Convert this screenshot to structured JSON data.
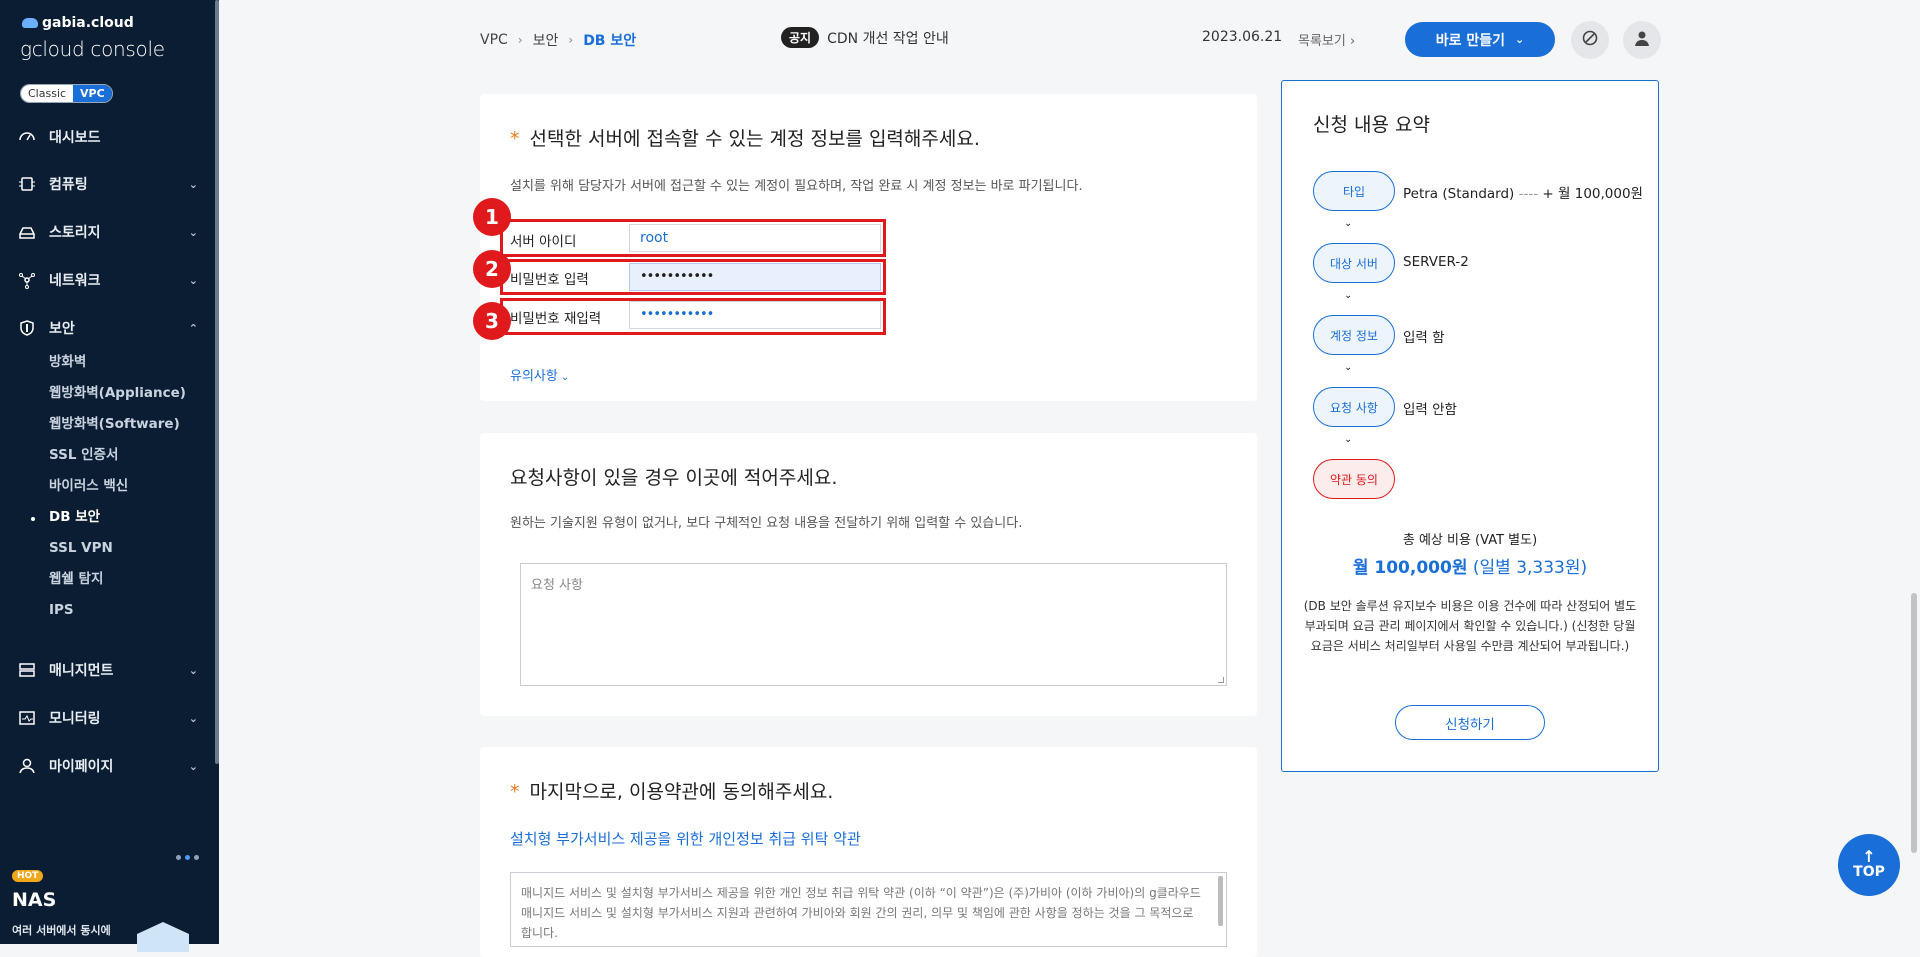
{
  "sidebar": {
    "brand_top": "gabia.cloud",
    "brand_main": "gcloud console",
    "mode_classic": "Classic",
    "mode_vpc": "VPC",
    "nav": {
      "dashboard": "대시보드",
      "computing": "컴퓨팅",
      "storage": "스토리지",
      "network": "네트워크",
      "security": "보안",
      "management": "매니지먼트",
      "monitoring": "모니터링",
      "mypage": "마이페이지"
    },
    "security_sub": [
      "방화벽",
      "웹방화벽(Appliance)",
      "웹방화벽(Software)",
      "SSL 인증서",
      "바이러스 백신",
      "DB 보안",
      "SSL VPN",
      "웹쉘 탐지",
      "IPS"
    ],
    "promo": {
      "hot": "HOT",
      "title": "NAS",
      "subtitle": "여러 서버에서 동시에"
    }
  },
  "topbar": {
    "breadcrumb": [
      "VPC",
      "보안",
      "DB 보안"
    ],
    "notice_tag": "공지",
    "notice_text": "CDN 개선 작업 안내",
    "notice_date": "2023.06.21",
    "notice_list": "목록보기",
    "make_button": "바로 만들기"
  },
  "account": {
    "title": "선택한 서버에 접속할 수 있는 계정 정보를 입력해주세요.",
    "desc": "설치를 위해 담당자가 서버에 접근할 수 있는 계정이 필요하며, 작업 완료 시 계정 정보는 바로 파기됩니다.",
    "id_label": "서버 아이디",
    "id_value": "root",
    "pw_label": "비밀번호 입력",
    "pw_value": "•••••••••••",
    "pw2_label": "비밀번호 재입력",
    "pw2_value": "•••••••••••",
    "caution": "유의사항",
    "badges": [
      "1",
      "2",
      "3"
    ]
  },
  "request": {
    "title": "요청사항이 있을 경우 이곳에 적어주세요.",
    "desc": "원하는 기술지원 유형이 없거나, 보다 구체적인 요청 내용을 전달하기 위해 입력할 수 있습니다.",
    "placeholder": "요청 사항"
  },
  "terms": {
    "title": "마지막으로, 이용약관에 동의해주세요.",
    "link": "설치형 부가서비스 제공을 위한 개인정보 취급 위탁 약관",
    "body": "매니지드 서비스 및 설치형 부가서비스 제공을 위한 개인 정보 취급 위탁 약관 (이하 “이 약관”)은 (주)가비아 (이하 가비아)의 g클라우드 매니지드 서비스 및 설치형 부가서비스 지원과 관련하여 가비아와 회원 간의 권리, 의무 및 책임에 관한 사항을 정하는 것을 그 목적으로 합니다."
  },
  "summary": {
    "title": "신청 내용 요약",
    "steps": [
      {
        "label": "타입",
        "value": "Petra (Standard)",
        "extra": "+ 월 100,000원"
      },
      {
        "label": "대상 서버",
        "value": "SERVER-2"
      },
      {
        "label": "계정 정보",
        "value": "입력 함"
      },
      {
        "label": "요청 사항",
        "value": "입력 안함"
      },
      {
        "label": "약관 동의",
        "value": ""
      }
    ],
    "total_label": "총 예상 비용 (VAT 별도)",
    "total_monthly": "월 100,000원",
    "total_daily": "(일별 3,333원)",
    "note": "(DB 보안 솔루션 유지보수 비용은 이용 건수에 따라 산정되어 별도 부과되며 요금 관리 페이지에서 확인할 수 있습니다.) (신청한 당월 요금은 서비스 처리일부터 사용일 수만큼 계산되어 부과됩니다.)",
    "apply": "신청하기"
  },
  "top_button": "TOP",
  "colors": {
    "accent": "#1a6ed8",
    "highlight": "#e0191c",
    "sidebar": "#0b1d33",
    "required": "#ef7b1a"
  }
}
